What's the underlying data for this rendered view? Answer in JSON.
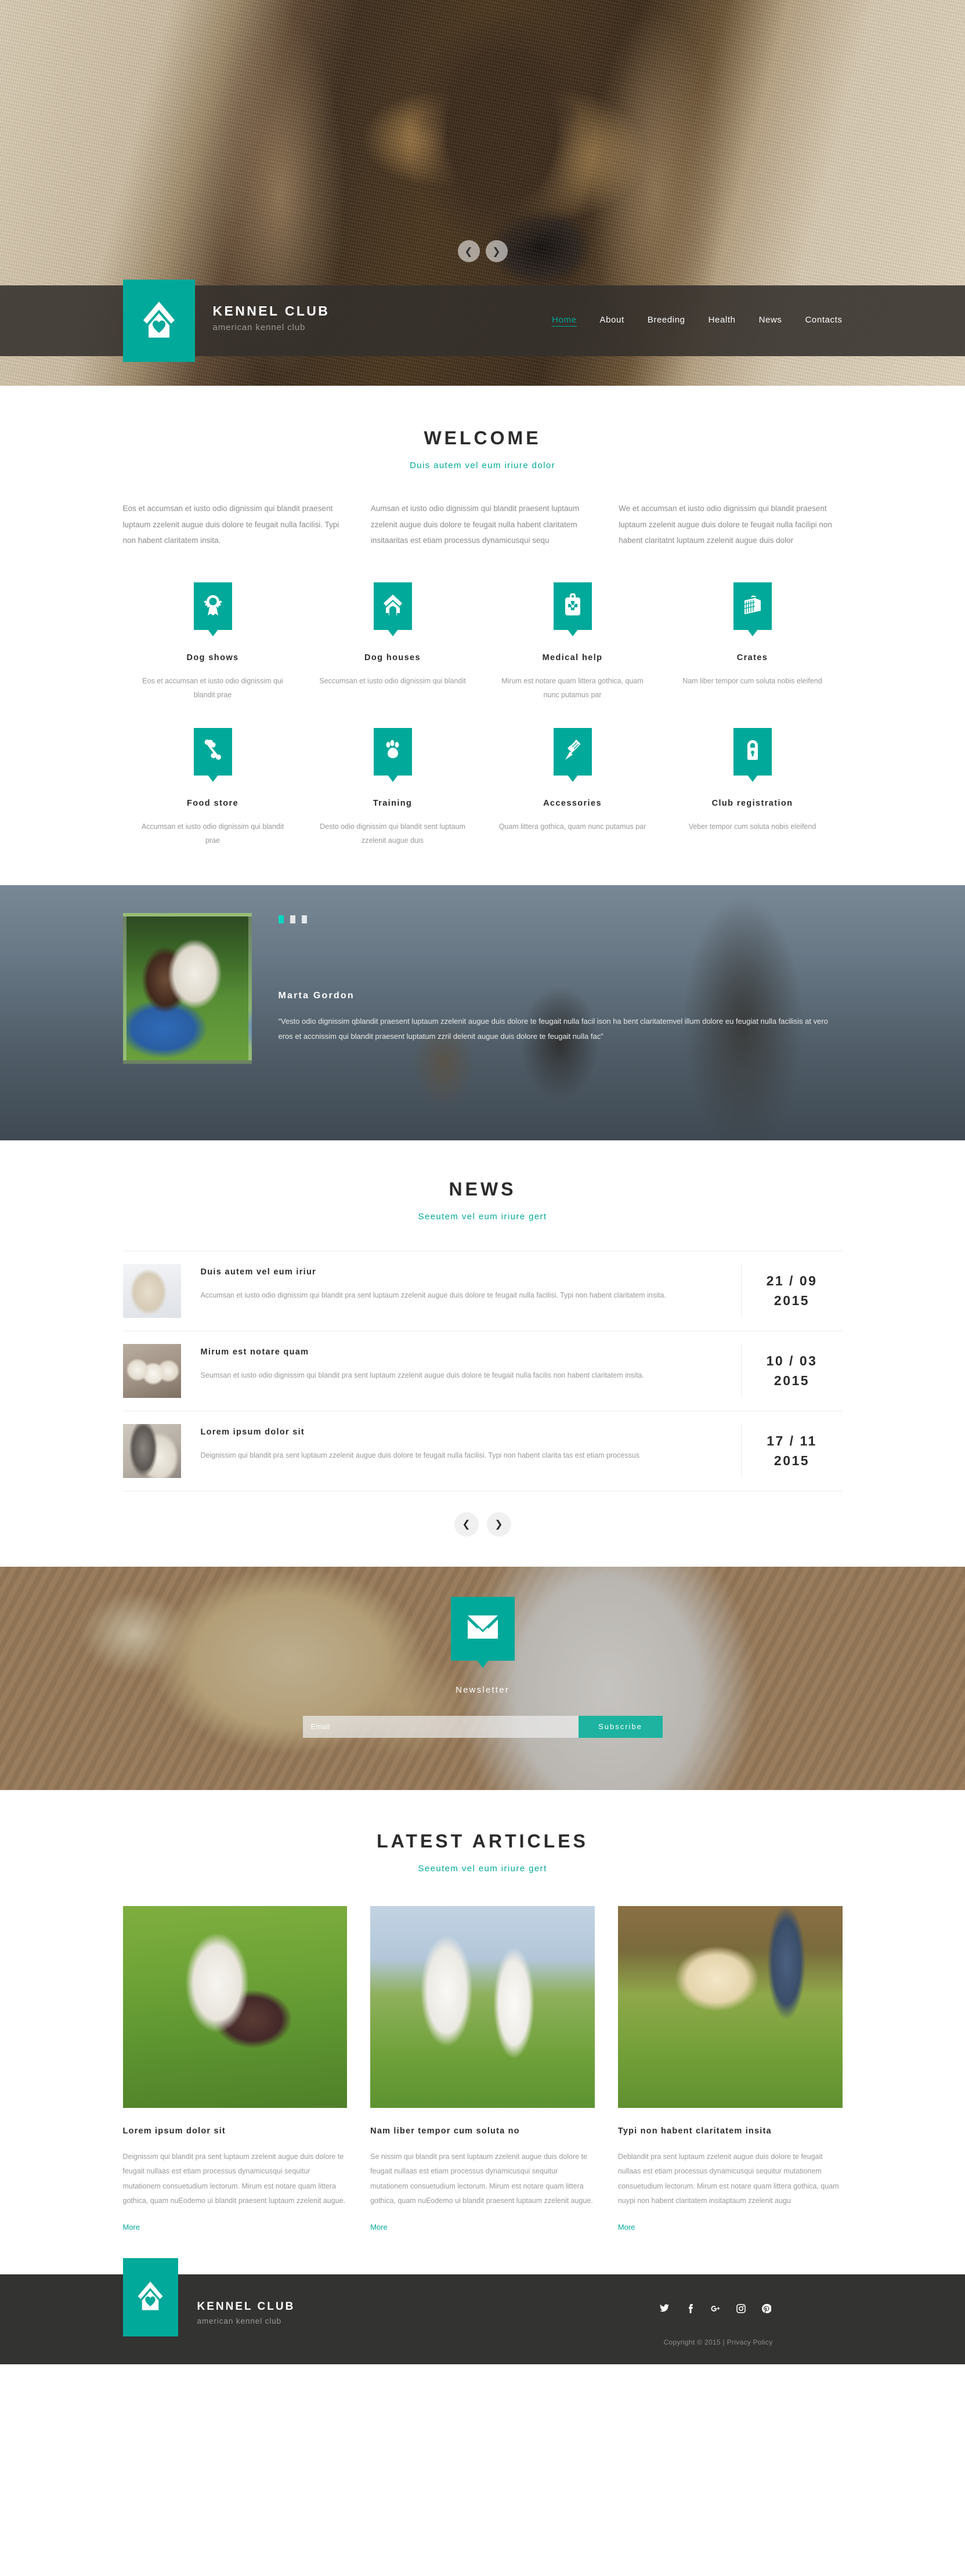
{
  "brand": {
    "name": "KENNEL CLUB",
    "tagline": "american kennel club",
    "logo_icon": "doghouse-heart-icon",
    "accent_color": "#00a99a",
    "header_bg": "#34302c",
    "footer_bg": "#333331"
  },
  "nav": {
    "items": [
      {
        "label": "Home",
        "active": true
      },
      {
        "label": "About",
        "active": false
      },
      {
        "label": "Breeding",
        "active": false
      },
      {
        "label": "Health",
        "active": false
      },
      {
        "label": "News",
        "active": false
      },
      {
        "label": "Contacts",
        "active": false
      }
    ]
  },
  "hero": {
    "prev_icon": "chevron-left-icon",
    "next_icon": "chevron-right-icon"
  },
  "welcome": {
    "title": "WELCOME",
    "subtitle": "Duis autem vel eum iriure dolor",
    "columns": [
      "Eos et accumsan et iusto odio dignissim qui blandit praesent luptaum zzelenit augue duis dolore te feugait nulla facilisi. Typi non habent claritatem insita.",
      "Aumsan et iusto odio dignissim qui blandit praesent luptaum zzelenit augue duis dolore te feugait nulla habent claritatem insitaaritas est etiam processus dynamicusqui sequ",
      "We et accumsan et iusto odio dignissim qui blandit praesent luptaum zzelenit augue duis dolore te feugait nulla facilipi non habent claritatnt luptaum zzelenit augue duis dolor"
    ]
  },
  "services": {
    "rows": [
      [
        {
          "icon": "rosette-award-icon",
          "title": "Dog shows",
          "text": "Eos et accumsan et iusto odio dignissim qui blandit prae"
        },
        {
          "icon": "doghouse-icon",
          "title": "Dog houses",
          "text": "Seccumsan et iusto odio dignissim qui blandit"
        },
        {
          "icon": "first-aid-kit-icon",
          "title": "Medical help",
          "text": "Mirum est notare quam littera gothica, quam nunc putamus par"
        },
        {
          "icon": "pet-crate-icon",
          "title": "Crates",
          "text": "Nam liber tempor cum soluta nobis eleifend"
        }
      ],
      [
        {
          "icon": "bone-icon",
          "title": "Food store",
          "text": "Accumsan et iusto odio dignissim qui blandit prae"
        },
        {
          "icon": "paw-print-icon",
          "title": "Training",
          "text": "Desto odio dignissim qui blandit sent luptaum zzelenit augue duis"
        },
        {
          "icon": "brush-icon",
          "title": "Accessories",
          "text": "Quam littera gothica, quam nunc putamus par"
        },
        {
          "icon": "lock-icon",
          "title": "Club registration",
          "text": "Veber tempor cum soluta nobis eleifend"
        }
      ]
    ]
  },
  "testimonial": {
    "dots": [
      true,
      false,
      false
    ],
    "name": "Marta Gordon",
    "quote": "“Vesto odio dignissim qblandit praesent luptaum zzelenit augue duis dolore te feugait nulla facil ison ha bent claritatemvel illum dolore eu feugiat nulla facilisis at vero eros et accnissim qui blandit praesent luptatum zzril delenit augue duis dolore te feugait nulla fac”",
    "photo_alt": "woman-with-poodle-photo"
  },
  "news": {
    "title": "NEWS",
    "subtitle": "Seeutem vel eum iriure gert",
    "items": [
      {
        "thumb": "white-dog-in-snow-photo",
        "title": "Duis autem vel eum iriur",
        "text": "Accumsan et iusto odio dignissim qui blandit pra sent luptaum zzelenit augue duis dolore te feugait nulla facilisi. Typi non habent claritatem insita.",
        "day": "21 / 09",
        "year": "2015"
      },
      {
        "thumb": "three-white-puppies-photo",
        "title": "Mirum est notare quam",
        "text": "Seumsan et iusto odio dignissim qui blandit pra sent luptaum zzelenit augue duis dolore te feugait nulla facilis non habent claritatem insita.",
        "day": "10 / 03",
        "year": "2015"
      },
      {
        "thumb": "husky-dog-photo",
        "title": "Lorem ipsum dolor sit",
        "text": "Deignissim qui blandit pra sent luptaum zzelenit augue duis dolore te feugait nulla facilisi. Typi non habent clarita tas est etiam processus",
        "day": "17 / 11",
        "year": "2015"
      }
    ],
    "prev_icon": "chevron-left-icon",
    "next_icon": "chevron-right-icon"
  },
  "newsletter": {
    "icon": "envelope-icon",
    "label": "Newsletter",
    "input_placeholder": "Email",
    "input_value": "",
    "button_label": "Subscribe"
  },
  "articles": {
    "title": "LATEST ARTICLES",
    "subtitle": "Seeutem vel eum iriure gert",
    "items": [
      {
        "image": "brindle-white-dog-on-grass-photo",
        "title": "Lorem ipsum dolor sit",
        "text": "Deignissim qui blandit pra sent luptaum zzelenit augue duis dolore te feugait nullaas est etiam processus dynamicusqui sequitur mutationem consuetudium lectorum. Mirum est notare quam littera gothica, quam nuEodemo ui blandit praesent luptaum zzelenit augue.",
        "more_label": "More"
      },
      {
        "image": "two-white-dogs-on-field-photo",
        "title": "Nam liber tempor cum soluta no",
        "text": "Se nissim qui blandit pra sent luptaum zzelenit augue duis dolore te feugait nullaas est etiam processus dynamicusqui sequitur mutationem consuetudium lectorum. Mirum est notare quam littera gothica, quam nuEodemo ui blandit praesent luptaum zzelenit augue.",
        "more_label": "More"
      },
      {
        "image": "labrador-jumping-for-treat-photo",
        "title": "Typi non habent claritatem insita",
        "text": "Deblandit pra sent luptaum zzelenit augue duis dolore te feugait nullaas est etiam processus dynamicusqui sequitur mutationem consuetudium lectorum. Mirum est notare quam littera gothica, quam nuypi non habent claritatem insitaptaum zzelenit augu",
        "more_label": "More"
      }
    ]
  },
  "footer": {
    "socials": [
      {
        "icon": "twitter-icon"
      },
      {
        "icon": "facebook-icon"
      },
      {
        "icon": "google-plus-icon"
      },
      {
        "icon": "instagram-icon"
      },
      {
        "icon": "pinterest-icon"
      }
    ],
    "copyright": "Copyright © 2015 | Privacy Policy"
  }
}
